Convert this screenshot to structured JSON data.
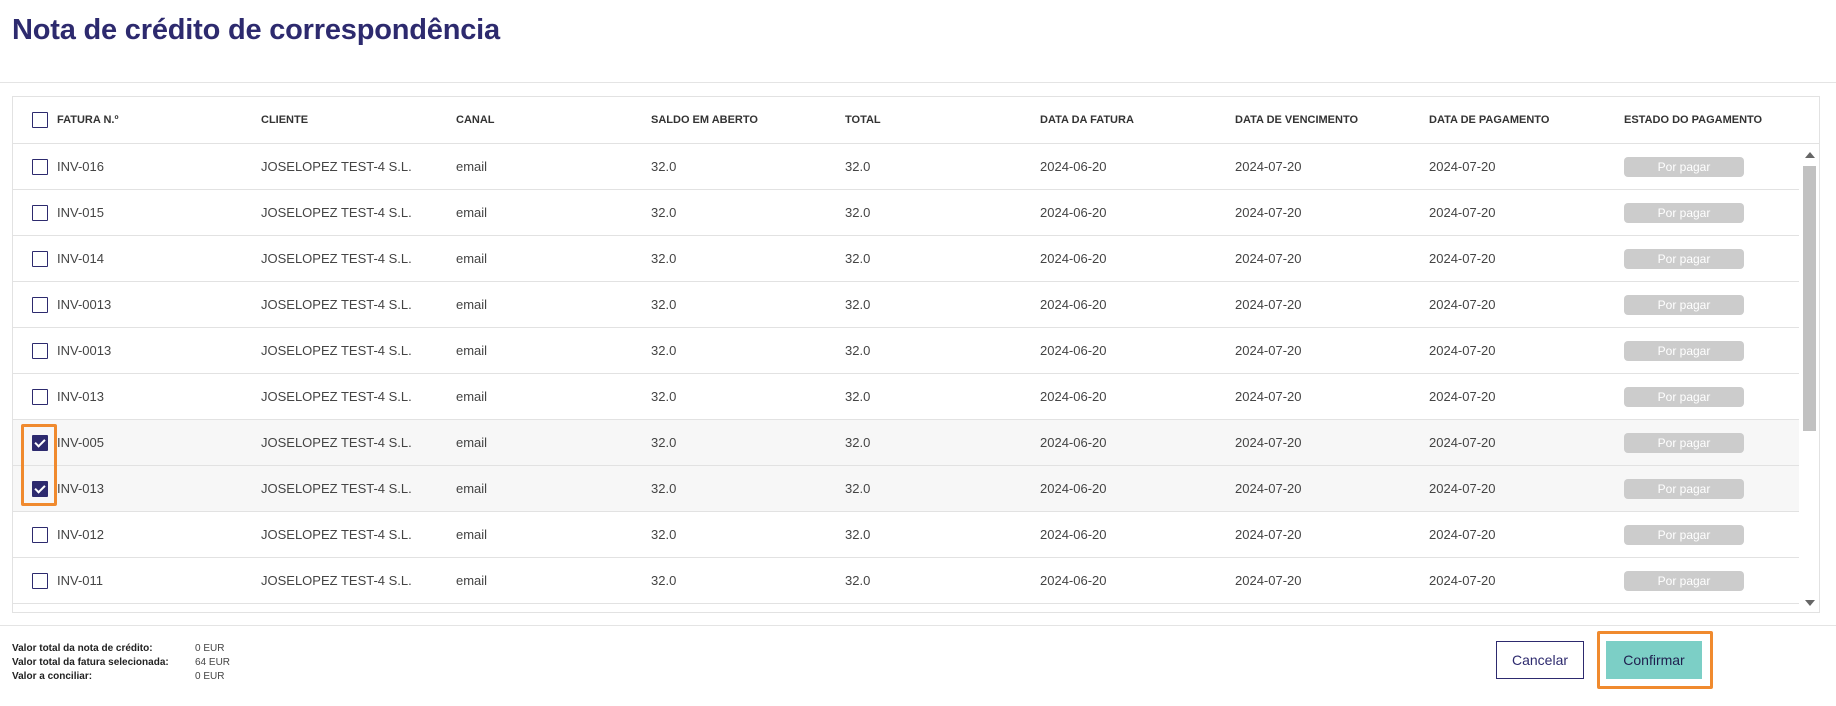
{
  "page": {
    "title": "Nota de crédito de correspondência"
  },
  "table": {
    "columns": [
      {
        "key": "invoice",
        "label": "FATURA N.º"
      },
      {
        "key": "client",
        "label": "CLIENTE"
      },
      {
        "key": "channel",
        "label": "CANAL"
      },
      {
        "key": "open_balance",
        "label": "SALDO EM ABERTO"
      },
      {
        "key": "total",
        "label": "TOTAL"
      },
      {
        "key": "invoice_date",
        "label": "DATA DA FATURA"
      },
      {
        "key": "due_date",
        "label": "DATA DE VENCIMENTO"
      },
      {
        "key": "payment_date",
        "label": "DATA DE PAGAMENTO"
      },
      {
        "key": "payment_status",
        "label": "ESTADO DO PAGAMENTO"
      }
    ],
    "rows": [
      {
        "checked": false,
        "invoice": "INV-016",
        "client": "JOSELOPEZ TEST-4 S.L.",
        "channel": "email",
        "open_balance": "32.0",
        "total": "32.0",
        "invoice_date": "2024-06-20",
        "due_date": "2024-07-20",
        "payment_date": "2024-07-20",
        "payment_status": "Por pagar"
      },
      {
        "checked": false,
        "invoice": "INV-015",
        "client": "JOSELOPEZ TEST-4 S.L.",
        "channel": "email",
        "open_balance": "32.0",
        "total": "32.0",
        "invoice_date": "2024-06-20",
        "due_date": "2024-07-20",
        "payment_date": "2024-07-20",
        "payment_status": "Por pagar"
      },
      {
        "checked": false,
        "invoice": "INV-014",
        "client": "JOSELOPEZ TEST-4 S.L.",
        "channel": "email",
        "open_balance": "32.0",
        "total": "32.0",
        "invoice_date": "2024-06-20",
        "due_date": "2024-07-20",
        "payment_date": "2024-07-20",
        "payment_status": "Por pagar"
      },
      {
        "checked": false,
        "invoice": "INV-0013",
        "client": "JOSELOPEZ TEST-4 S.L.",
        "channel": "email",
        "open_balance": "32.0",
        "total": "32.0",
        "invoice_date": "2024-06-20",
        "due_date": "2024-07-20",
        "payment_date": "2024-07-20",
        "payment_status": "Por pagar"
      },
      {
        "checked": false,
        "invoice": "INV-0013",
        "client": "JOSELOPEZ TEST-4 S.L.",
        "channel": "email",
        "open_balance": "32.0",
        "total": "32.0",
        "invoice_date": "2024-06-20",
        "due_date": "2024-07-20",
        "payment_date": "2024-07-20",
        "payment_status": "Por pagar"
      },
      {
        "checked": false,
        "invoice": "INV-013",
        "client": "JOSELOPEZ TEST-4 S.L.",
        "channel": "email",
        "open_balance": "32.0",
        "total": "32.0",
        "invoice_date": "2024-06-20",
        "due_date": "2024-07-20",
        "payment_date": "2024-07-20",
        "payment_status": "Por pagar"
      },
      {
        "checked": true,
        "invoice": "INV-005",
        "client": "JOSELOPEZ TEST-4 S.L.",
        "channel": "email",
        "open_balance": "32.0",
        "total": "32.0",
        "invoice_date": "2024-06-20",
        "due_date": "2024-07-20",
        "payment_date": "2024-07-20",
        "payment_status": "Por pagar"
      },
      {
        "checked": true,
        "invoice": "INV-013",
        "client": "JOSELOPEZ TEST-4 S.L.",
        "channel": "email",
        "open_balance": "32.0",
        "total": "32.0",
        "invoice_date": "2024-06-20",
        "due_date": "2024-07-20",
        "payment_date": "2024-07-20",
        "payment_status": "Por pagar"
      },
      {
        "checked": false,
        "invoice": "INV-012",
        "client": "JOSELOPEZ TEST-4 S.L.",
        "channel": "email",
        "open_balance": "32.0",
        "total": "32.0",
        "invoice_date": "2024-06-20",
        "due_date": "2024-07-20",
        "payment_date": "2024-07-20",
        "payment_status": "Por pagar"
      },
      {
        "checked": false,
        "invoice": "INV-011",
        "client": "JOSELOPEZ TEST-4 S.L.",
        "channel": "email",
        "open_balance": "32.0",
        "total": "32.0",
        "invoice_date": "2024-06-20",
        "due_date": "2024-07-20",
        "payment_date": "2024-07-20",
        "payment_status": "Por pagar"
      }
    ]
  },
  "summary": [
    {
      "label": "Valor total da nota de crédito:",
      "value": "0 EUR"
    },
    {
      "label": "Valor total da fatura selecionada:",
      "value": "64 EUR"
    },
    {
      "label": "Valor a conciliar:",
      "value": "0 EUR"
    }
  ],
  "actions": {
    "cancel_label": "Cancelar",
    "confirm_label": "Confirmar"
  },
  "colors": {
    "brand": "#2d2a6e",
    "confirm": "#7ccfc6",
    "badge": "#cccccc",
    "highlight": "#f08a2e"
  }
}
